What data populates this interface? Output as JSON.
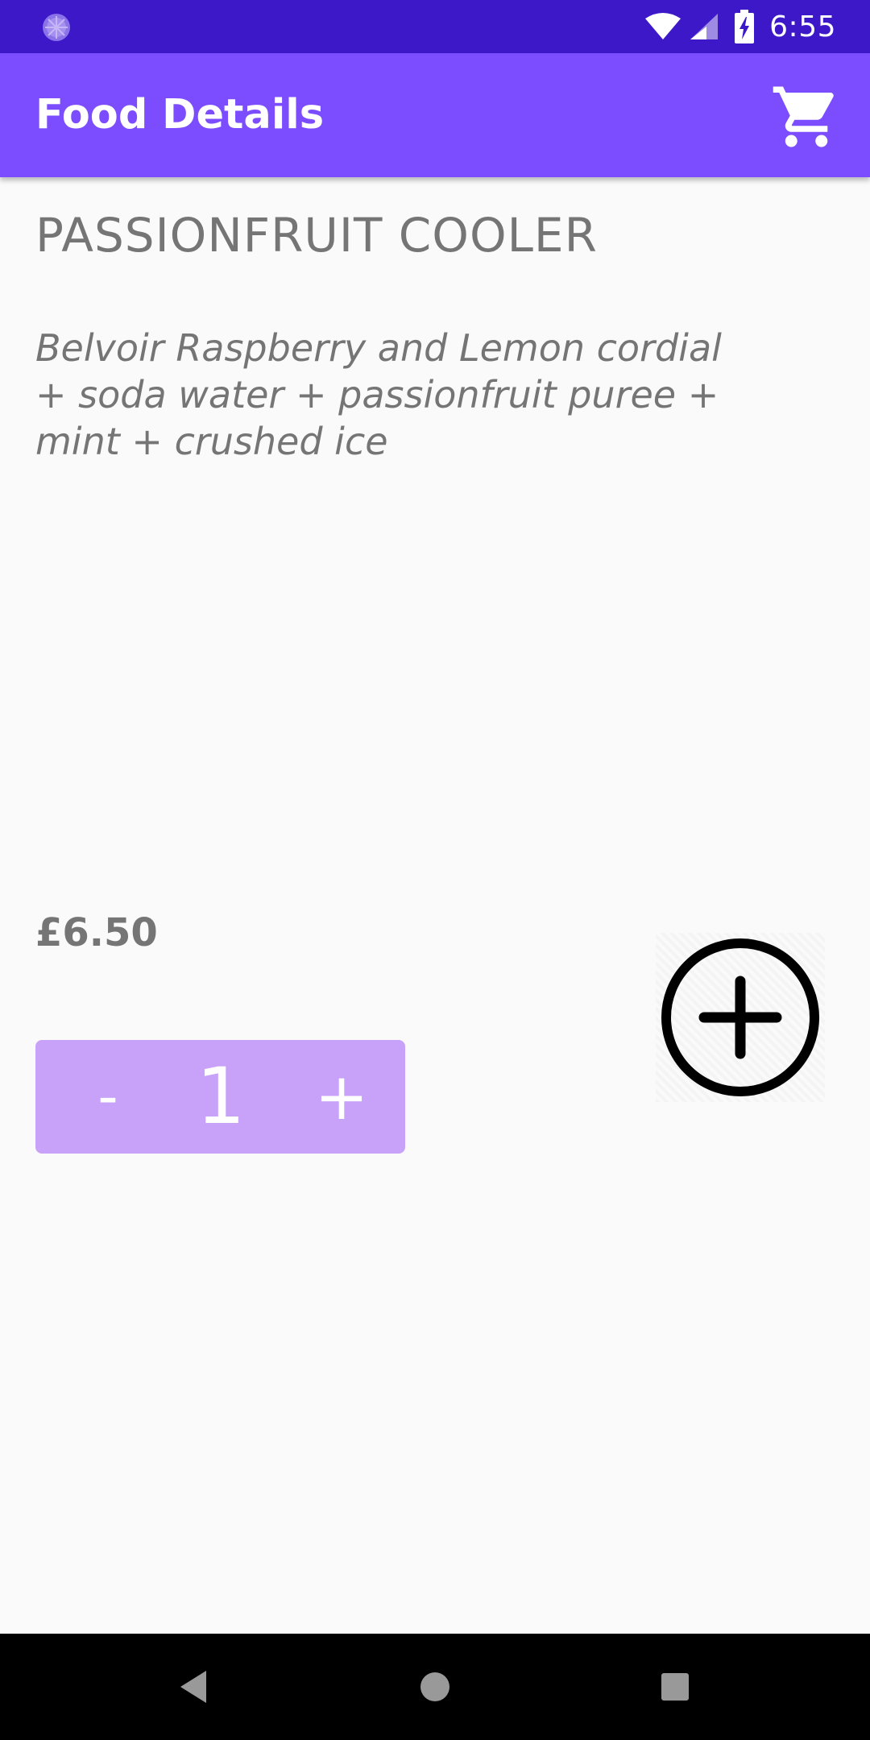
{
  "status_bar": {
    "time": "6:55",
    "icons": [
      "app-notification-icon",
      "wifi-icon",
      "cell-signal-icon",
      "battery-charging-icon"
    ]
  },
  "app_bar": {
    "title": "Food Details",
    "cart_icon": "shopping-cart-icon"
  },
  "food": {
    "name": "PASSIONFRUIT COOLER",
    "description": "Belvoir Raspberry and Lemon cordial + soda water + passionfruit puree + mint + crushed ice",
    "price": "£6.50"
  },
  "quantity": {
    "minus_label": "-",
    "value": "1",
    "plus_label": "+"
  },
  "add_button": {
    "icon": "add-circle-icon"
  },
  "nav_bar": {
    "icons": [
      "back-icon",
      "home-icon",
      "recents-icon"
    ]
  },
  "colors": {
    "status_bar": "#3d18c8",
    "app_bar": "#7c4dff",
    "stepper": "#c8a2f8",
    "text_secondary": "#757575",
    "background": "#fafafa"
  }
}
